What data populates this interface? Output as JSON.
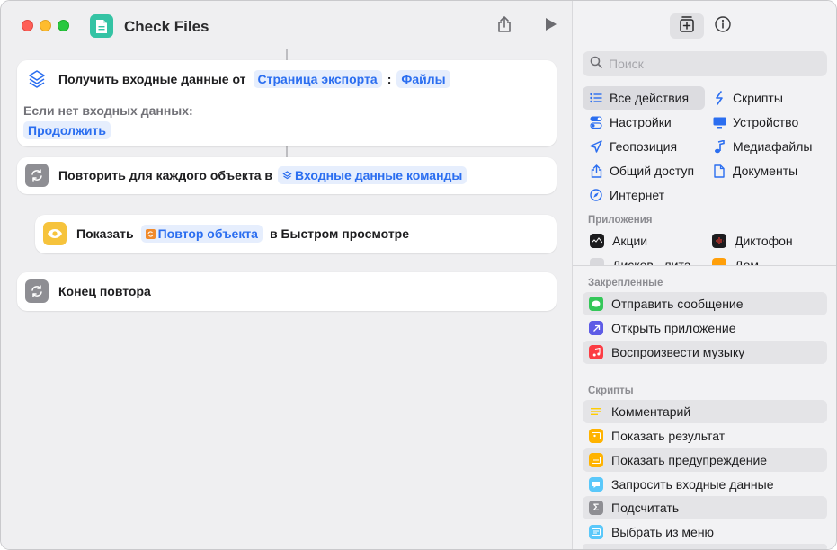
{
  "window": {
    "title": "Check Files"
  },
  "editor": {
    "action1": {
      "label": "Получить входные данные от",
      "token1": "Страница экспорта",
      "sep": ":",
      "token2": "Файлы",
      "fallback_label": "Если нет входных данных:",
      "fallback_value": "Продолжить"
    },
    "action2": {
      "label": "Повторить для каждого объекта в",
      "token": "Входные данные команды"
    },
    "action3": {
      "label_before": "Показать",
      "token": "Повтор объекта",
      "label_after": "в Быстром просмотре"
    },
    "action4": {
      "label": "Конец повтора"
    }
  },
  "panel": {
    "search_placeholder": "Поиск",
    "categories": [
      {
        "label": "Все действия",
        "icon": "list-icon"
      },
      {
        "label": "Скрипты",
        "icon": "script-icon"
      },
      {
        "label": "Настройки",
        "icon": "toggle-icon"
      },
      {
        "label": "Устройство",
        "icon": "monitor-icon"
      },
      {
        "label": "Геопозиция",
        "icon": "location-icon"
      },
      {
        "label": "Медиафайлы",
        "icon": "music-note-icon"
      },
      {
        "label": "Общий доступ",
        "icon": "share-icon"
      },
      {
        "label": "Документы",
        "icon": "document-icon"
      },
      {
        "label": "Интернет",
        "icon": "compass-icon"
      }
    ],
    "apps_label": "Приложения",
    "apps": [
      {
        "label": "Акции"
      },
      {
        "label": "Диктофон"
      },
      {
        "label": "Дисков...лита"
      },
      {
        "label": "Дом"
      }
    ],
    "pinned_label": "Закрепленные",
    "pinned": [
      {
        "label": "Отправить сообщение",
        "color": "#34c759"
      },
      {
        "label": "Открыть приложение",
        "color": "#5e5ce6"
      },
      {
        "label": "Воспроизвести музыку",
        "color": "#fc3c44"
      }
    ],
    "scripts_label": "Скрипты",
    "scripts": [
      {
        "label": "Комментарий",
        "color": "#ffcc00"
      },
      {
        "label": "Показать результат",
        "color": "#ffb300"
      },
      {
        "label": "Показать предупреждение",
        "color": "#ffb300"
      },
      {
        "label": "Запросить входные данные",
        "color": "#5ac8fa"
      },
      {
        "label": "Подсчитать",
        "color": "#8e8e93"
      },
      {
        "label": "Выбрать из меню",
        "color": "#5ac8fa"
      }
    ]
  },
  "colors": {
    "accent": "#2b6ef0",
    "token_bg": "#e6eefd",
    "app_icon": "#34c3a4"
  }
}
